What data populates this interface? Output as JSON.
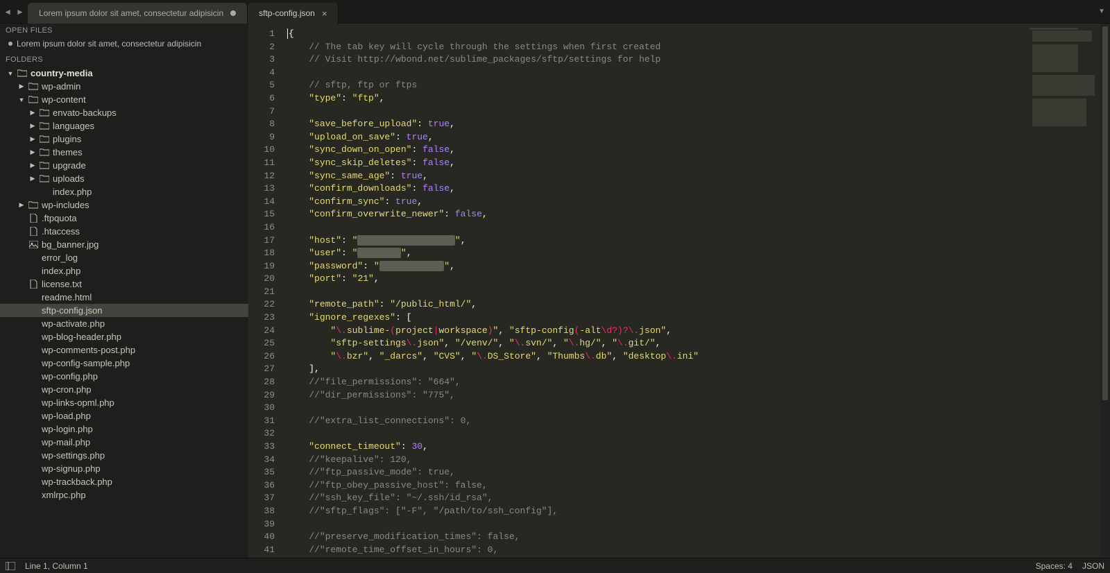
{
  "tabbar": {
    "navBack": "◄",
    "navFwd": "►",
    "menuCaret": "▼",
    "tabs": [
      {
        "label": "Lorem ipsum dolor sit amet, consectetur adipisicin",
        "dirty": true,
        "active": false
      },
      {
        "label": "sftp-config.json",
        "dirty": false,
        "active": true
      }
    ]
  },
  "sidebar": {
    "openFilesTitle": "OPEN FILES",
    "openFile": "Lorem ipsum dolor sit amet, consectetur adipisicin",
    "foldersTitle": "FOLDERS",
    "tree": [
      {
        "depth": 0,
        "twisty": "▼",
        "icon": "folder",
        "label": "country-media",
        "bold": true
      },
      {
        "depth": 1,
        "twisty": "▶",
        "icon": "folder",
        "label": "wp-admin"
      },
      {
        "depth": 1,
        "twisty": "▼",
        "icon": "folder",
        "label": "wp-content"
      },
      {
        "depth": 2,
        "twisty": "▶",
        "icon": "folder",
        "label": "envato-backups"
      },
      {
        "depth": 2,
        "twisty": "▶",
        "icon": "folder",
        "label": "languages"
      },
      {
        "depth": 2,
        "twisty": "▶",
        "icon": "folder",
        "label": "plugins"
      },
      {
        "depth": 2,
        "twisty": "▶",
        "icon": "folder",
        "label": "themes"
      },
      {
        "depth": 2,
        "twisty": "▶",
        "icon": "folder",
        "label": "upgrade"
      },
      {
        "depth": 2,
        "twisty": "▶",
        "icon": "folder",
        "label": "uploads"
      },
      {
        "depth": 2,
        "twisty": "",
        "icon": "none",
        "label": "index.php"
      },
      {
        "depth": 1,
        "twisty": "▶",
        "icon": "folder",
        "label": "wp-includes"
      },
      {
        "depth": 1,
        "twisty": "",
        "icon": "file",
        "label": ".ftpquota"
      },
      {
        "depth": 1,
        "twisty": "",
        "icon": "file",
        "label": ".htaccess"
      },
      {
        "depth": 1,
        "twisty": "",
        "icon": "img",
        "label": "bg_banner.jpg"
      },
      {
        "depth": 1,
        "twisty": "",
        "icon": "none",
        "label": "error_log"
      },
      {
        "depth": 1,
        "twisty": "",
        "icon": "none",
        "label": "index.php"
      },
      {
        "depth": 1,
        "twisty": "",
        "icon": "file",
        "label": "license.txt"
      },
      {
        "depth": 1,
        "twisty": "",
        "icon": "none",
        "label": "readme.html"
      },
      {
        "depth": 1,
        "twisty": "",
        "icon": "none",
        "label": "sftp-config.json",
        "selected": true
      },
      {
        "depth": 1,
        "twisty": "",
        "icon": "none",
        "label": "wp-activate.php"
      },
      {
        "depth": 1,
        "twisty": "",
        "icon": "none",
        "label": "wp-blog-header.php"
      },
      {
        "depth": 1,
        "twisty": "",
        "icon": "none",
        "label": "wp-comments-post.php"
      },
      {
        "depth": 1,
        "twisty": "",
        "icon": "none",
        "label": "wp-config-sample.php"
      },
      {
        "depth": 1,
        "twisty": "",
        "icon": "none",
        "label": "wp-config.php"
      },
      {
        "depth": 1,
        "twisty": "",
        "icon": "none",
        "label": "wp-cron.php"
      },
      {
        "depth": 1,
        "twisty": "",
        "icon": "none",
        "label": "wp-links-opml.php"
      },
      {
        "depth": 1,
        "twisty": "",
        "icon": "none",
        "label": "wp-load.php"
      },
      {
        "depth": 1,
        "twisty": "",
        "icon": "none",
        "label": "wp-login.php"
      },
      {
        "depth": 1,
        "twisty": "",
        "icon": "none",
        "label": "wp-mail.php"
      },
      {
        "depth": 1,
        "twisty": "",
        "icon": "none",
        "label": "wp-settings.php"
      },
      {
        "depth": 1,
        "twisty": "",
        "icon": "none",
        "label": "wp-signup.php"
      },
      {
        "depth": 1,
        "twisty": "",
        "icon": "none",
        "label": "wp-trackback.php"
      },
      {
        "depth": 1,
        "twisty": "",
        "icon": "none",
        "label": "xmlrpc.php"
      }
    ]
  },
  "editor": {
    "lines": [
      [
        {
          "t": "caret"
        },
        {
          "t": "punc",
          "s": "{"
        }
      ],
      [
        {
          "t": "indent",
          "n": 1
        },
        {
          "t": "comment",
          "s": "// The tab key will cycle through the settings when first created"
        }
      ],
      [
        {
          "t": "indent",
          "n": 1
        },
        {
          "t": "comment",
          "s": "// Visit http://wbond.net/sublime_packages/sftp/settings for help"
        }
      ],
      [],
      [
        {
          "t": "indent",
          "n": 1
        },
        {
          "t": "comment",
          "s": "// sftp, ftp or ftps"
        }
      ],
      [
        {
          "t": "indent",
          "n": 1
        },
        {
          "t": "key",
          "s": "\"type\""
        },
        {
          "t": "punc",
          "s": ": "
        },
        {
          "t": "str",
          "s": "\"ftp\""
        },
        {
          "t": "punc",
          "s": ","
        }
      ],
      [],
      [
        {
          "t": "indent",
          "n": 1
        },
        {
          "t": "key",
          "s": "\"save_before_upload\""
        },
        {
          "t": "punc",
          "s": ": "
        },
        {
          "t": "kw",
          "s": "true"
        },
        {
          "t": "punc",
          "s": ","
        }
      ],
      [
        {
          "t": "indent",
          "n": 1
        },
        {
          "t": "key",
          "s": "\"upload_on_save\""
        },
        {
          "t": "punc",
          "s": ": "
        },
        {
          "t": "kw",
          "s": "true"
        },
        {
          "t": "punc",
          "s": ","
        }
      ],
      [
        {
          "t": "indent",
          "n": 1
        },
        {
          "t": "key",
          "s": "\"sync_down_on_open\""
        },
        {
          "t": "punc",
          "s": ": "
        },
        {
          "t": "kw",
          "s": "false"
        },
        {
          "t": "punc",
          "s": ","
        }
      ],
      [
        {
          "t": "indent",
          "n": 1
        },
        {
          "t": "key",
          "s": "\"sync_skip_deletes\""
        },
        {
          "t": "punc",
          "s": ": "
        },
        {
          "t": "kw",
          "s": "false"
        },
        {
          "t": "punc",
          "s": ","
        }
      ],
      [
        {
          "t": "indent",
          "n": 1
        },
        {
          "t": "key",
          "s": "\"sync_same_age\""
        },
        {
          "t": "punc",
          "s": ": "
        },
        {
          "t": "kw",
          "s": "true"
        },
        {
          "t": "punc",
          "s": ","
        }
      ],
      [
        {
          "t": "indent",
          "n": 1
        },
        {
          "t": "key",
          "s": "\"confirm_downloads\""
        },
        {
          "t": "punc",
          "s": ": "
        },
        {
          "t": "kw",
          "s": "false"
        },
        {
          "t": "punc",
          "s": ","
        }
      ],
      [
        {
          "t": "indent",
          "n": 1
        },
        {
          "t": "key",
          "s": "\"confirm_sync\""
        },
        {
          "t": "punc",
          "s": ": "
        },
        {
          "t": "kw",
          "s": "true"
        },
        {
          "t": "punc",
          "s": ","
        }
      ],
      [
        {
          "t": "indent",
          "n": 1
        },
        {
          "t": "key",
          "s": "\"confirm_overwrite_newer\""
        },
        {
          "t": "punc",
          "s": ": "
        },
        {
          "t": "kw",
          "s": "false"
        },
        {
          "t": "punc",
          "s": ","
        }
      ],
      [],
      [
        {
          "t": "indent",
          "n": 1
        },
        {
          "t": "key",
          "s": "\"host\""
        },
        {
          "t": "punc",
          "s": ": "
        },
        {
          "t": "str",
          "s": "\""
        },
        {
          "t": "censor",
          "s": "xxxxxxxxxxxxxxxxxx"
        },
        {
          "t": "str",
          "s": "\""
        },
        {
          "t": "punc",
          "s": ","
        }
      ],
      [
        {
          "t": "indent",
          "n": 1
        },
        {
          "t": "key",
          "s": "\"user\""
        },
        {
          "t": "punc",
          "s": ": "
        },
        {
          "t": "str",
          "s": "\""
        },
        {
          "t": "censor",
          "s": "xxxxxxxx"
        },
        {
          "t": "str",
          "s": "\""
        },
        {
          "t": "punc",
          "s": ","
        }
      ],
      [
        {
          "t": "indent",
          "n": 1
        },
        {
          "t": "key",
          "s": "\"password\""
        },
        {
          "t": "punc",
          "s": ": "
        },
        {
          "t": "str",
          "s": "\""
        },
        {
          "t": "censor",
          "s": "xxxxxxxxxxxx"
        },
        {
          "t": "str",
          "s": "\""
        },
        {
          "t": "punc",
          "s": ","
        }
      ],
      [
        {
          "t": "indent",
          "n": 1
        },
        {
          "t": "key",
          "s": "\"port\""
        },
        {
          "t": "punc",
          "s": ": "
        },
        {
          "t": "str",
          "s": "\"21\""
        },
        {
          "t": "punc",
          "s": ","
        }
      ],
      [],
      [
        {
          "t": "indent",
          "n": 1
        },
        {
          "t": "key",
          "s": "\"remote_path\""
        },
        {
          "t": "punc",
          "s": ": "
        },
        {
          "t": "str",
          "s": "\"/public_html/\""
        },
        {
          "t": "punc",
          "s": ","
        }
      ],
      [
        {
          "t": "indent",
          "n": 1
        },
        {
          "t": "key",
          "s": "\"ignore_regexes\""
        },
        {
          "t": "punc",
          "s": ": ["
        }
      ],
      [
        {
          "t": "indent",
          "n": 2
        },
        {
          "t": "str",
          "s": "\""
        },
        {
          "t": "rx",
          "s": "\\\\."
        },
        {
          "t": "str",
          "s": "sublime-"
        },
        {
          "t": "rx",
          "s": "("
        },
        {
          "t": "str",
          "s": "project"
        },
        {
          "t": "rx",
          "s": "|"
        },
        {
          "t": "str",
          "s": "workspace"
        },
        {
          "t": "rx",
          "s": ")"
        },
        {
          "t": "str",
          "s": "\""
        },
        {
          "t": "punc",
          "s": ", "
        },
        {
          "t": "str",
          "s": "\"sftp-config"
        },
        {
          "t": "rx",
          "s": "("
        },
        {
          "t": "str",
          "s": "-alt"
        },
        {
          "t": "rx",
          "s": "\\\\d?)?\\\\."
        },
        {
          "t": "str",
          "s": "json\""
        },
        {
          "t": "punc",
          "s": ","
        }
      ],
      [
        {
          "t": "indent",
          "n": 2
        },
        {
          "t": "str",
          "s": "\"sftp-settings"
        },
        {
          "t": "rx",
          "s": "\\\\."
        },
        {
          "t": "str",
          "s": "json\""
        },
        {
          "t": "punc",
          "s": ", "
        },
        {
          "t": "str",
          "s": "\"/venv/\""
        },
        {
          "t": "punc",
          "s": ", "
        },
        {
          "t": "str",
          "s": "\""
        },
        {
          "t": "rx",
          "s": "\\\\."
        },
        {
          "t": "str",
          "s": "svn/\""
        },
        {
          "t": "punc",
          "s": ", "
        },
        {
          "t": "str",
          "s": "\""
        },
        {
          "t": "rx",
          "s": "\\\\."
        },
        {
          "t": "str",
          "s": "hg/\""
        },
        {
          "t": "punc",
          "s": ", "
        },
        {
          "t": "str",
          "s": "\""
        },
        {
          "t": "rx",
          "s": "\\\\."
        },
        {
          "t": "str",
          "s": "git/\""
        },
        {
          "t": "punc",
          "s": ","
        }
      ],
      [
        {
          "t": "indent",
          "n": 2
        },
        {
          "t": "str",
          "s": "\""
        },
        {
          "t": "rx",
          "s": "\\\\."
        },
        {
          "t": "str",
          "s": "bzr\""
        },
        {
          "t": "punc",
          "s": ", "
        },
        {
          "t": "str",
          "s": "\"_darcs\""
        },
        {
          "t": "punc",
          "s": ", "
        },
        {
          "t": "str",
          "s": "\"CVS\""
        },
        {
          "t": "punc",
          "s": ", "
        },
        {
          "t": "str",
          "s": "\""
        },
        {
          "t": "rx",
          "s": "\\\\."
        },
        {
          "t": "str",
          "s": "DS_Store\""
        },
        {
          "t": "punc",
          "s": ", "
        },
        {
          "t": "str",
          "s": "\"Thumbs"
        },
        {
          "t": "rx",
          "s": "\\\\."
        },
        {
          "t": "str",
          "s": "db\""
        },
        {
          "t": "punc",
          "s": ", "
        },
        {
          "t": "str",
          "s": "\"desktop"
        },
        {
          "t": "rx",
          "s": "\\\\."
        },
        {
          "t": "str",
          "s": "ini\""
        }
      ],
      [
        {
          "t": "indent",
          "n": 1
        },
        {
          "t": "punc",
          "s": "],"
        }
      ],
      [
        {
          "t": "indent",
          "n": 1
        },
        {
          "t": "comment",
          "s": "//\"file_permissions\": \"664\","
        }
      ],
      [
        {
          "t": "indent",
          "n": 1
        },
        {
          "t": "comment",
          "s": "//\"dir_permissions\": \"775\","
        }
      ],
      [],
      [
        {
          "t": "indent",
          "n": 1
        },
        {
          "t": "comment",
          "s": "//\"extra_list_connections\": 0,"
        }
      ],
      [],
      [
        {
          "t": "indent",
          "n": 1
        },
        {
          "t": "key",
          "s": "\"connect_timeout\""
        },
        {
          "t": "punc",
          "s": ": "
        },
        {
          "t": "kw",
          "s": "30"
        },
        {
          "t": "punc",
          "s": ","
        }
      ],
      [
        {
          "t": "indent",
          "n": 1
        },
        {
          "t": "comment",
          "s": "//\"keepalive\": 120,"
        }
      ],
      [
        {
          "t": "indent",
          "n": 1
        },
        {
          "t": "comment",
          "s": "//\"ftp_passive_mode\": true,"
        }
      ],
      [
        {
          "t": "indent",
          "n": 1
        },
        {
          "t": "comment",
          "s": "//\"ftp_obey_passive_host\": false,"
        }
      ],
      [
        {
          "t": "indent",
          "n": 1
        },
        {
          "t": "comment",
          "s": "//\"ssh_key_file\": \"~/.ssh/id_rsa\","
        }
      ],
      [
        {
          "t": "indent",
          "n": 1
        },
        {
          "t": "comment",
          "s": "//\"sftp_flags\": [\"-F\", \"/path/to/ssh_config\"],"
        }
      ],
      [],
      [
        {
          "t": "indent",
          "n": 1
        },
        {
          "t": "comment",
          "s": "//\"preserve_modification_times\": false,"
        }
      ],
      [
        {
          "t": "indent",
          "n": 1
        },
        {
          "t": "comment",
          "s": "//\"remote_time_offset_in_hours\": 0,"
        }
      ]
    ]
  },
  "statusbar": {
    "position": "Line 1, Column 1",
    "spaces": "Spaces: 4",
    "syntax": "JSON"
  }
}
